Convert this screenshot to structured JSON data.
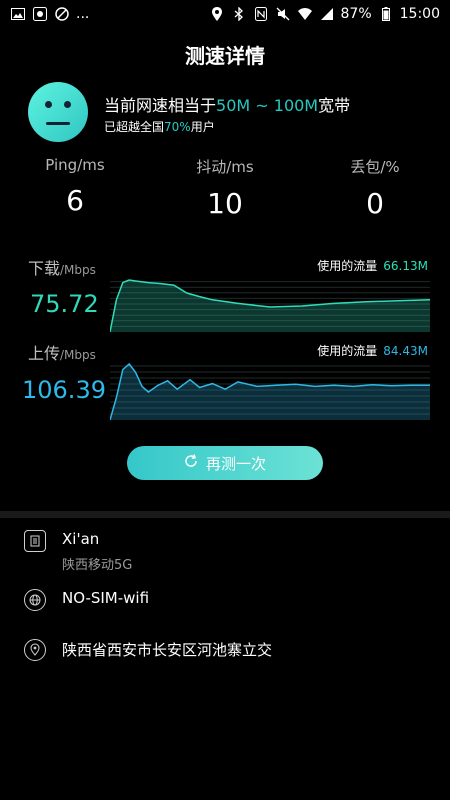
{
  "status_bar": {
    "time": "15:00",
    "battery": "87%",
    "dots": "..."
  },
  "header": {
    "title": "测速详情"
  },
  "summary": {
    "speed_prefix": "当前网速相当于",
    "speed_range": "50M ~ 100M",
    "speed_suffix": "宽带",
    "beat_prefix": "已超越全国",
    "beat_percent": "70%",
    "beat_suffix": "用户"
  },
  "metrics": [
    {
      "label": "Ping/ms",
      "value": "6"
    },
    {
      "label": "抖动/ms",
      "value": "10"
    },
    {
      "label": "丢包/%",
      "value": "0"
    }
  ],
  "download": {
    "label": "下载",
    "unit": "/Mbps",
    "usage_label": "使用的流量",
    "usage_value": "66.13M",
    "speed": "75.72",
    "color": "#2fdcba"
  },
  "upload": {
    "label": "上传",
    "unit": "/Mbps",
    "usage_label": "使用的流量",
    "usage_value": "84.43M",
    "speed": "106.39",
    "color": "#2db8e6"
  },
  "retest_button": {
    "label": "再测一次",
    "icon": "refresh-icon"
  },
  "info": {
    "location_primary": "Xi'an",
    "carrier": "陕西移动5G",
    "network": "NO-SIM-wifi",
    "address": "陕西省西安市长安区河池寨立交"
  },
  "chart_data": [
    {
      "type": "area",
      "name": "download",
      "x": [
        0,
        0.02,
        0.04,
        0.06,
        0.08,
        0.12,
        0.16,
        0.2,
        0.24,
        0.28,
        0.32,
        0.4,
        0.5,
        0.6,
        0.7,
        0.8,
        0.9,
        1.0
      ],
      "values": [
        0,
        0.62,
        0.95,
        1.0,
        0.98,
        0.95,
        0.93,
        0.9,
        0.75,
        0.68,
        0.62,
        0.55,
        0.48,
        0.5,
        0.55,
        0.58,
        0.6,
        0.62
      ]
    },
    {
      "type": "area",
      "name": "upload",
      "x": [
        0,
        0.02,
        0.04,
        0.06,
        0.08,
        0.1,
        0.12,
        0.15,
        0.18,
        0.21,
        0.25,
        0.28,
        0.32,
        0.36,
        0.4,
        0.46,
        0.52,
        0.58,
        0.64,
        0.7,
        0.76,
        0.82,
        0.88,
        0.94,
        1.0
      ],
      "values": [
        0,
        0.4,
        0.9,
        1.0,
        0.85,
        0.6,
        0.5,
        0.62,
        0.7,
        0.55,
        0.72,
        0.58,
        0.65,
        0.55,
        0.68,
        0.6,
        0.62,
        0.64,
        0.6,
        0.62,
        0.6,
        0.63,
        0.61,
        0.62,
        0.62
      ]
    }
  ]
}
